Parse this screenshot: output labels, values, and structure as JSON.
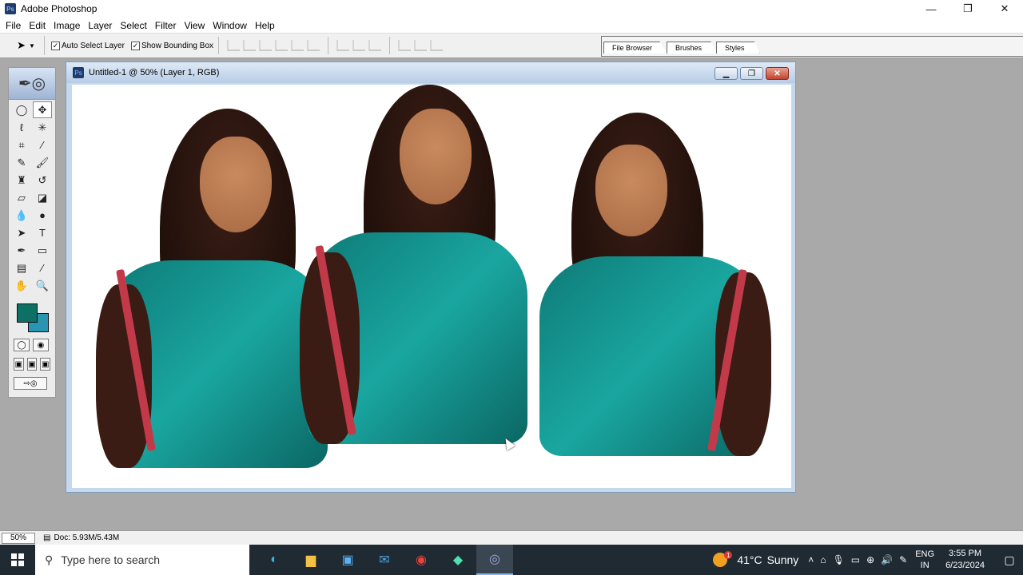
{
  "window": {
    "title": "Adobe Photoshop",
    "minimize": "—",
    "restore": "❐",
    "close": "✕"
  },
  "menu": [
    "File",
    "Edit",
    "Image",
    "Layer",
    "Select",
    "Filter",
    "View",
    "Window",
    "Help"
  ],
  "options": {
    "auto_select_label": "Auto Select Layer",
    "auto_select_checked": "✓",
    "bounding_box_label": "Show Bounding Box",
    "bounding_box_checked": "✓"
  },
  "palette_well": {
    "tabs": [
      "File Browser",
      "Brushes",
      "Styles"
    ]
  },
  "toolbox": {
    "foreground_color": "#0d7064",
    "background_color": "#2a95b2"
  },
  "document": {
    "title": "Untitled-1 @ 50% (Layer 1, RGB)"
  },
  "status": {
    "zoom": "50%",
    "doc_size": "Doc: 5.93M/5.43M"
  },
  "taskbar": {
    "search_placeholder": "Type here to search",
    "weather_temp": "41°C",
    "weather_desc": "Sunny",
    "weather_badge": "1",
    "lang_top": "ENG",
    "lang_bottom": "IN",
    "time": "3:55 PM",
    "date": "6/23/2024"
  }
}
